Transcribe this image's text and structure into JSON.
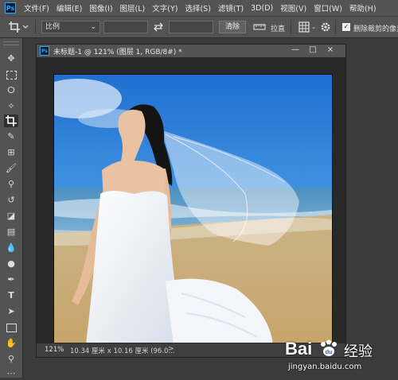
{
  "app": {
    "logo": "Ps"
  },
  "menu": [
    "文件(F)",
    "编辑(E)",
    "图像(I)",
    "图层(L)",
    "文字(Y)",
    "选择(S)",
    "滤镜(T)",
    "3D(D)",
    "视图(V)",
    "窗口(W)",
    "帮助(H)"
  ],
  "options": {
    "ratio_select": "比例",
    "swap_icon": "swap-arrows",
    "clear_button": "清除",
    "straighten_label": "拉直",
    "delete_crop_checkbox": true,
    "delete_crop_label": "删除裁剪的像素"
  },
  "document": {
    "title": "未标题-1 @ 121% (图层 1, RGB/8#) *",
    "zoom": "121%",
    "size_info": "10.34 厘米 x 10.16 厘米 (96.0...",
    "status_arrow": ">",
    "minimize": "—",
    "maximize": "□",
    "close": "×"
  },
  "watermark": {
    "brand": "Bai",
    "brand2": "经验",
    "site": "jingyan.baidu.com"
  },
  "colors": {
    "ui_dark": "#535353",
    "canvas_bg": "#282828",
    "ps_blue": "#31a8ff"
  }
}
